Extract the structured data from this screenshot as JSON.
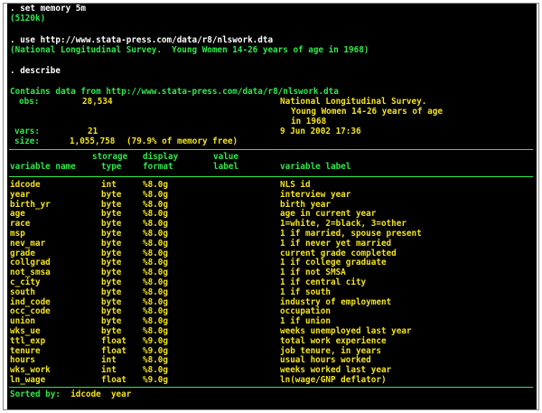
{
  "commands": {
    "set_memory": ". set memory 5m",
    "set_memory_result": "(5120k)",
    "use": ". use http://www.stata-press.com/data/r8/nlswork.dta",
    "use_result": "(National Longitudinal Survey.  Young Women 14-26 years of age in 1968)",
    "describe": ". describe"
  },
  "describe": {
    "contains_label": "Contains data from",
    "source": "http://www.stata-press.com/data/r8/nlswork.dta",
    "obs_label": "obs:",
    "obs_value": "28,534",
    "dataset_label_lines": [
      "National Longitudinal Survey.",
      "Young Women 14-26 years of age",
      "in 1968"
    ],
    "vars_label": "vars:",
    "vars_value": "21",
    "date": "9 Jun 2002 17:36",
    "size_label": "size:",
    "size_value": "1,055,758",
    "size_note": "(79.9% of memory free)",
    "header": {
      "storage": "storage",
      "display": "display",
      "value": "value",
      "variable_name": "variable name",
      "type": "type",
      "format": "format",
      "label": "label",
      "variable_label": "variable label"
    },
    "variables": [
      {
        "name": "idcode",
        "type": "int",
        "format": "%8.0g",
        "label": "NLS id"
      },
      {
        "name": "year",
        "type": "byte",
        "format": "%8.0g",
        "label": "interview year"
      },
      {
        "name": "birth_yr",
        "type": "byte",
        "format": "%8.0g",
        "label": "birth year"
      },
      {
        "name": "age",
        "type": "byte",
        "format": "%8.0g",
        "label": "age in current year"
      },
      {
        "name": "race",
        "type": "byte",
        "format": "%8.0g",
        "label": "1=white, 2=black, 3=other"
      },
      {
        "name": "msp",
        "type": "byte",
        "format": "%8.0g",
        "label": "1 if married, spouse present"
      },
      {
        "name": "nev_mar",
        "type": "byte",
        "format": "%8.0g",
        "label": "1 if never yet married"
      },
      {
        "name": "grade",
        "type": "byte",
        "format": "%8.0g",
        "label": "current grade completed"
      },
      {
        "name": "collgrad",
        "type": "byte",
        "format": "%8.0g",
        "label": "1 if college graduate"
      },
      {
        "name": "not_smsa",
        "type": "byte",
        "format": "%8.0g",
        "label": "1 if not SMSA"
      },
      {
        "name": "c_city",
        "type": "byte",
        "format": "%8.0g",
        "label": "1 if central city"
      },
      {
        "name": "south",
        "type": "byte",
        "format": "%8.0g",
        "label": "1 if south"
      },
      {
        "name": "ind_code",
        "type": "byte",
        "format": "%8.0g",
        "label": "industry of employment"
      },
      {
        "name": "occ_code",
        "type": "byte",
        "format": "%8.0g",
        "label": "occupation"
      },
      {
        "name": "union",
        "type": "byte",
        "format": "%8.0g",
        "label": "1 if union"
      },
      {
        "name": "wks_ue",
        "type": "byte",
        "format": "%8.0g",
        "label": "weeks unemployed last year"
      },
      {
        "name": "ttl_exp",
        "type": "float",
        "format": "%9.0g",
        "label": "total work experience"
      },
      {
        "name": "tenure",
        "type": "float",
        "format": "%9.0g",
        "label": "job tenure, in years"
      },
      {
        "name": "hours",
        "type": "int",
        "format": "%8.0g",
        "label": "usual hours worked"
      },
      {
        "name": "wks_work",
        "type": "int",
        "format": "%8.0g",
        "label": "weeks worked last year"
      },
      {
        "name": "ln_wage",
        "type": "float",
        "format": "%9.0g",
        "label": "ln(wage/GNP deflator)"
      }
    ],
    "sorted_label": "Sorted by:",
    "sorted_by": "idcode  year"
  },
  "colors": {
    "background": "#000000",
    "command_text": "#ffffff",
    "result_text": "#2ee84a",
    "value_text": "#f2e21c"
  }
}
